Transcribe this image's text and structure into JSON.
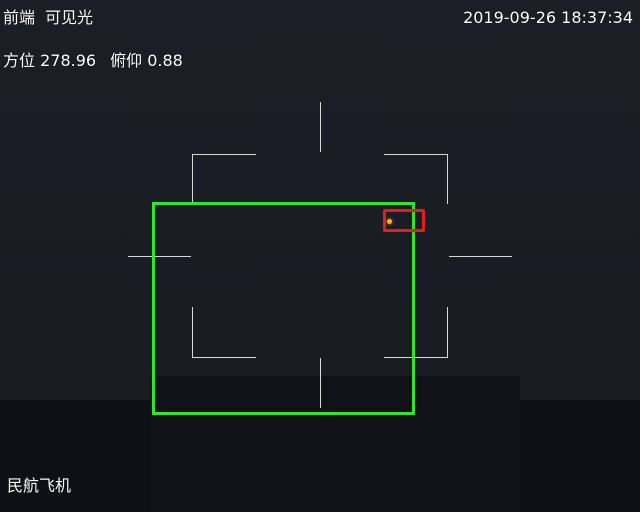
{
  "osd": {
    "channel": "前端",
    "mode": "可见光",
    "datetime": "2019-09-26 18:37:34",
    "azimuth_label": "方位",
    "azimuth_value": "278.96",
    "pitch_label": "俯仰",
    "pitch_value": "0.88",
    "target_class": "民航飞机"
  },
  "colors": {
    "tracking_box": "#2ee62a",
    "target_box": "#e01f1f",
    "reticle": "#d8d8d8",
    "text": "#ffffff"
  }
}
